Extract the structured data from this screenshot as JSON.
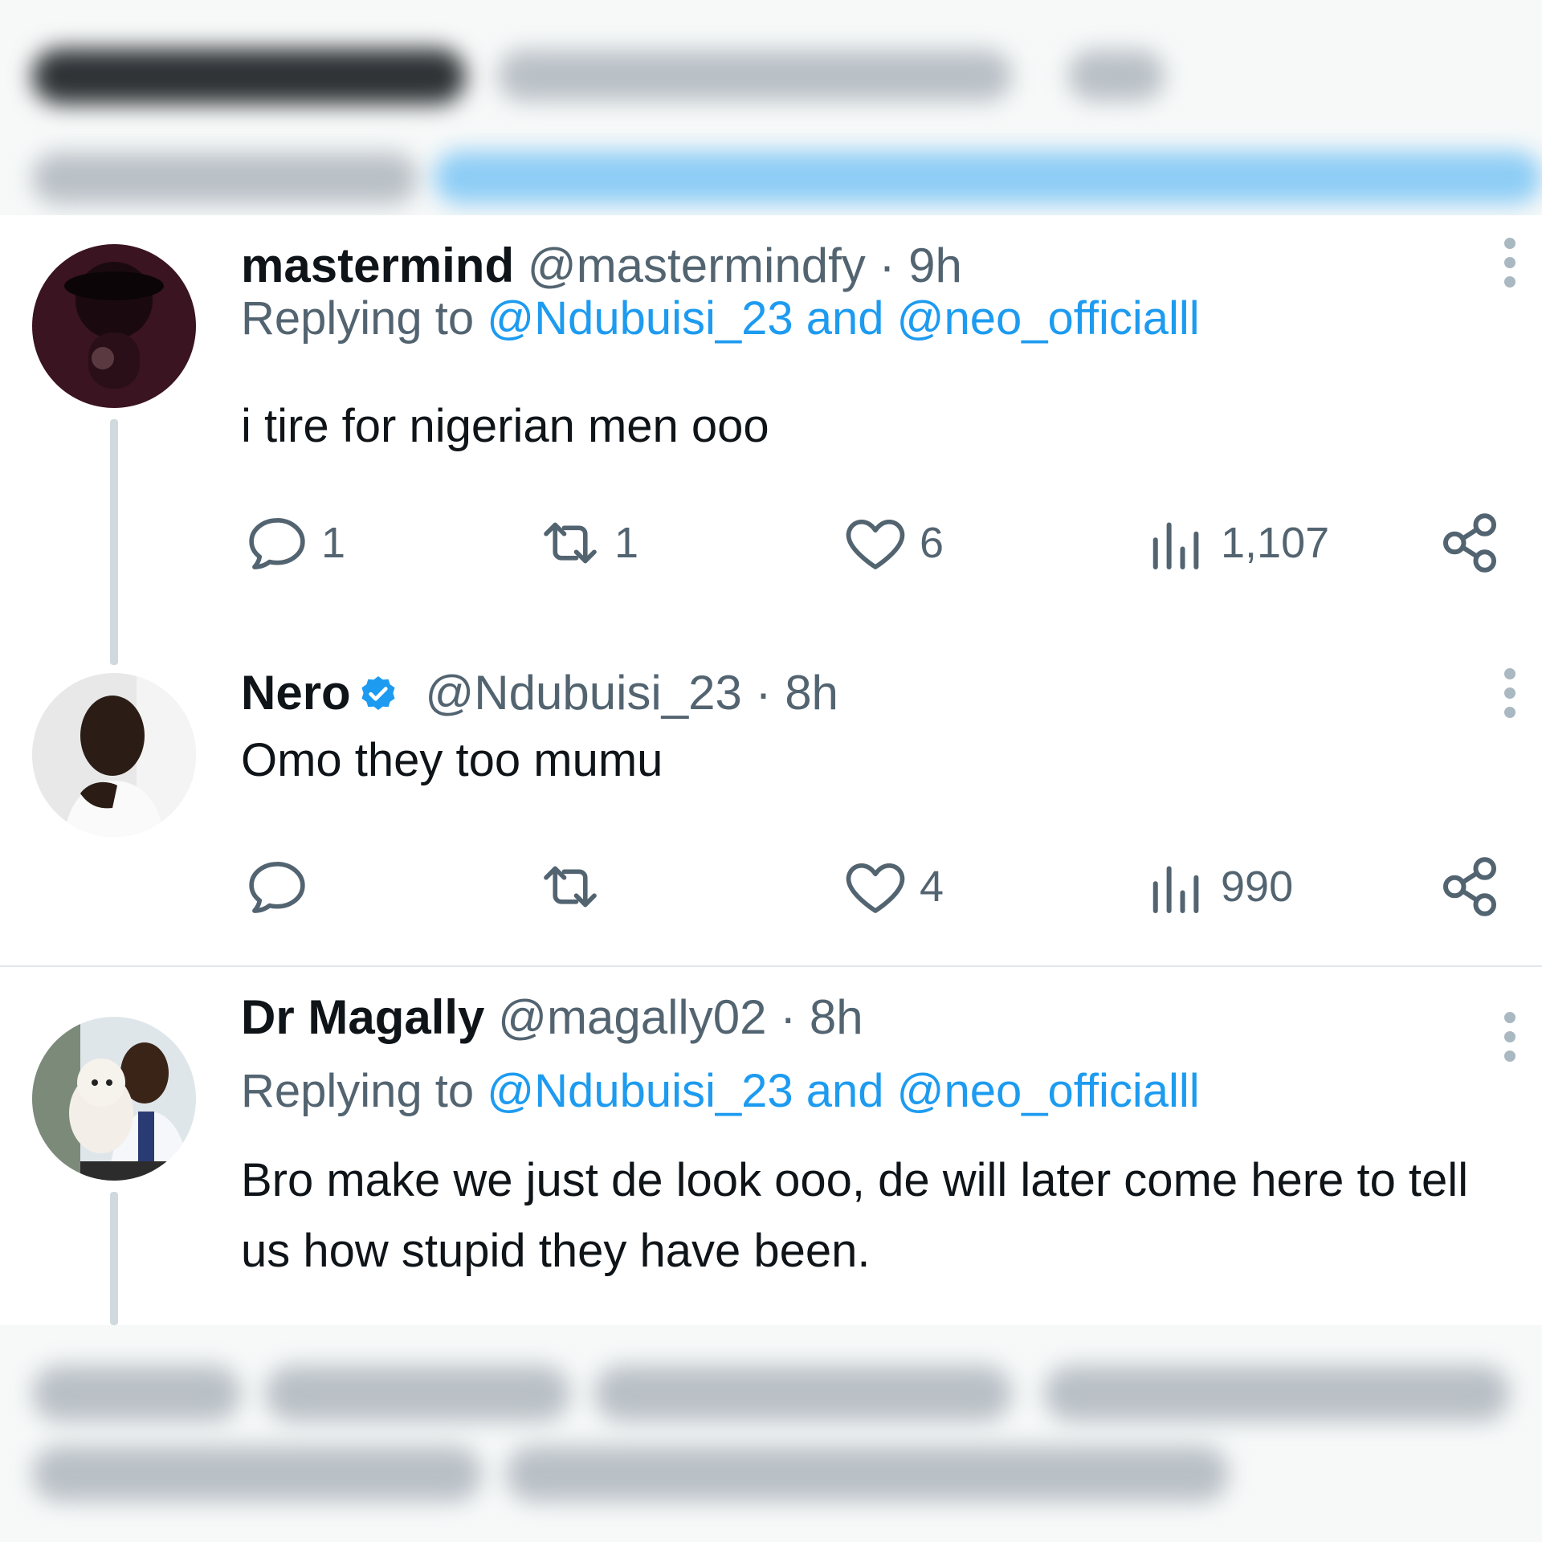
{
  "tweets": [
    {
      "name": "mastermind",
      "handle": "@mastermindfy",
      "separator": "·",
      "time": "9h",
      "reply_prefix": "Replying to ",
      "reply_mentions": "@Ndubuisi_23 and @neo_officialll",
      "text": "i tire for nigerian men ooo",
      "reply_count": "1",
      "retweet_count": "1",
      "like_count": "6",
      "view_count": "1,107"
    },
    {
      "name": "Nero",
      "verified": true,
      "handle": "@Ndubuisi_23",
      "separator": "·",
      "time": "8h",
      "text": "Omo they too mumu",
      "reply_count": "",
      "retweet_count": "",
      "like_count": "4",
      "view_count": "990"
    },
    {
      "name": "Dr Magally",
      "handle": "@magally02",
      "separator": "·",
      "time": "8h",
      "reply_prefix": "Replying to ",
      "reply_mentions": "@Ndubuisi_23 and @neo_officialll",
      "text": "Bro make we just de look ooo, de will later come here to tell us how stupid they have been."
    }
  ],
  "colors": {
    "accent": "#1d9bf0",
    "secondary_text": "#536471",
    "primary_text": "#0f1419",
    "thread_line": "#cfd9de"
  },
  "icons": [
    "reply-icon",
    "retweet-icon",
    "like-icon",
    "views-icon",
    "share-icon",
    "more-icon",
    "verified-icon"
  ]
}
